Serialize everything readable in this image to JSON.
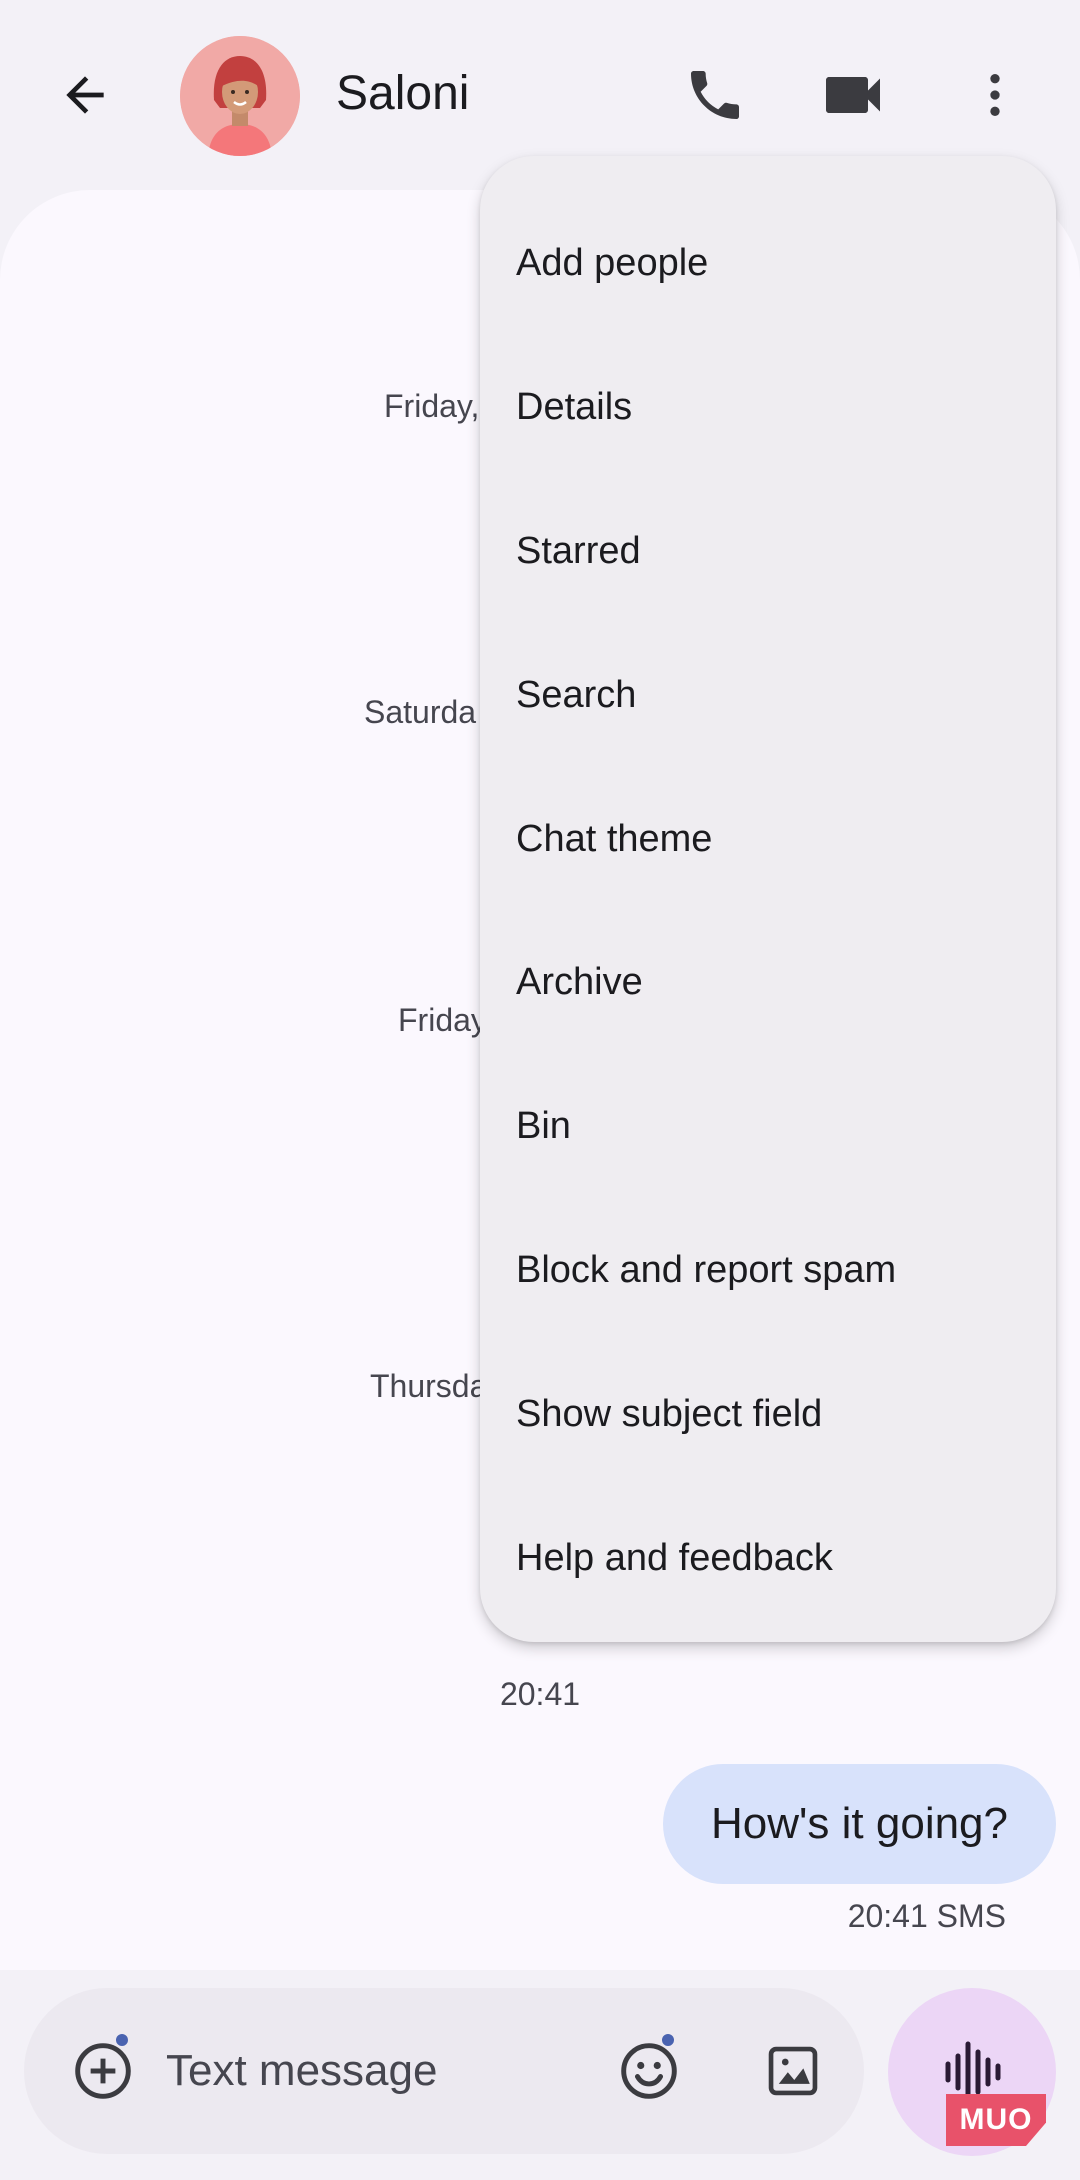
{
  "header": {
    "contact_name": "Saloni",
    "icons": [
      "back-arrow-icon",
      "phone-icon",
      "video-camera-icon",
      "more-vert-icon"
    ]
  },
  "conversation": {
    "date_separators": [
      "Friday,",
      "Saturda",
      "Friday",
      "Thursda"
    ],
    "time_separator": "20:41",
    "messages": [
      {
        "text": "How's it going?",
        "time": "20:41",
        "type": "SMS",
        "outgoing": true
      }
    ]
  },
  "composer": {
    "placeholder": "Text message"
  },
  "menu": {
    "items": [
      "Add people",
      "Details",
      "Starred",
      "Search",
      "Chat theme",
      "Archive",
      "Bin",
      "Block and report spam",
      "Show subject field",
      "Help and feedback"
    ]
  },
  "watermark": {
    "text": "MUO"
  },
  "colors": {
    "background": "#f3f1f7",
    "surface": "#fbf8fe",
    "bubble": "#d8e2fb",
    "menu": "#efedf1",
    "voice_button": "#ecd6f6",
    "badge_dot": "#4a63b0"
  }
}
